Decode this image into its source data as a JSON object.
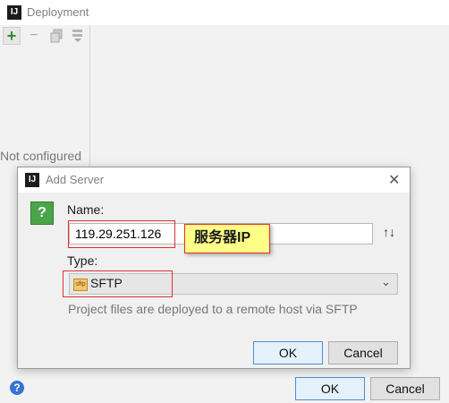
{
  "outer_window": {
    "app_icon": "IJ",
    "title": "Deployment",
    "toolbar": {
      "add": "+",
      "remove": "−",
      "copy": "copy-icon",
      "move": "move-icon"
    },
    "empty_text": "Not configured",
    "help": "?",
    "ok_label": "OK",
    "cancel_label": "Cancel"
  },
  "dialog": {
    "app_icon": "IJ",
    "title": "Add Server",
    "close": "✕",
    "name_label": "Name:",
    "name_value": "119.29.251.126",
    "annotation": "服务器IP",
    "sort_icon": "↑↓",
    "type_label": "Type:",
    "type_icon_text": "sftp",
    "type_value": "SFTP",
    "type_description": "Project files are deployed to a remote host via SFTP",
    "ok_label": "OK",
    "cancel_label": "Cancel"
  },
  "colors": {
    "highlight": "#e03030",
    "annotation_bg": "#ffff88",
    "accent": "#4a8fd9"
  }
}
